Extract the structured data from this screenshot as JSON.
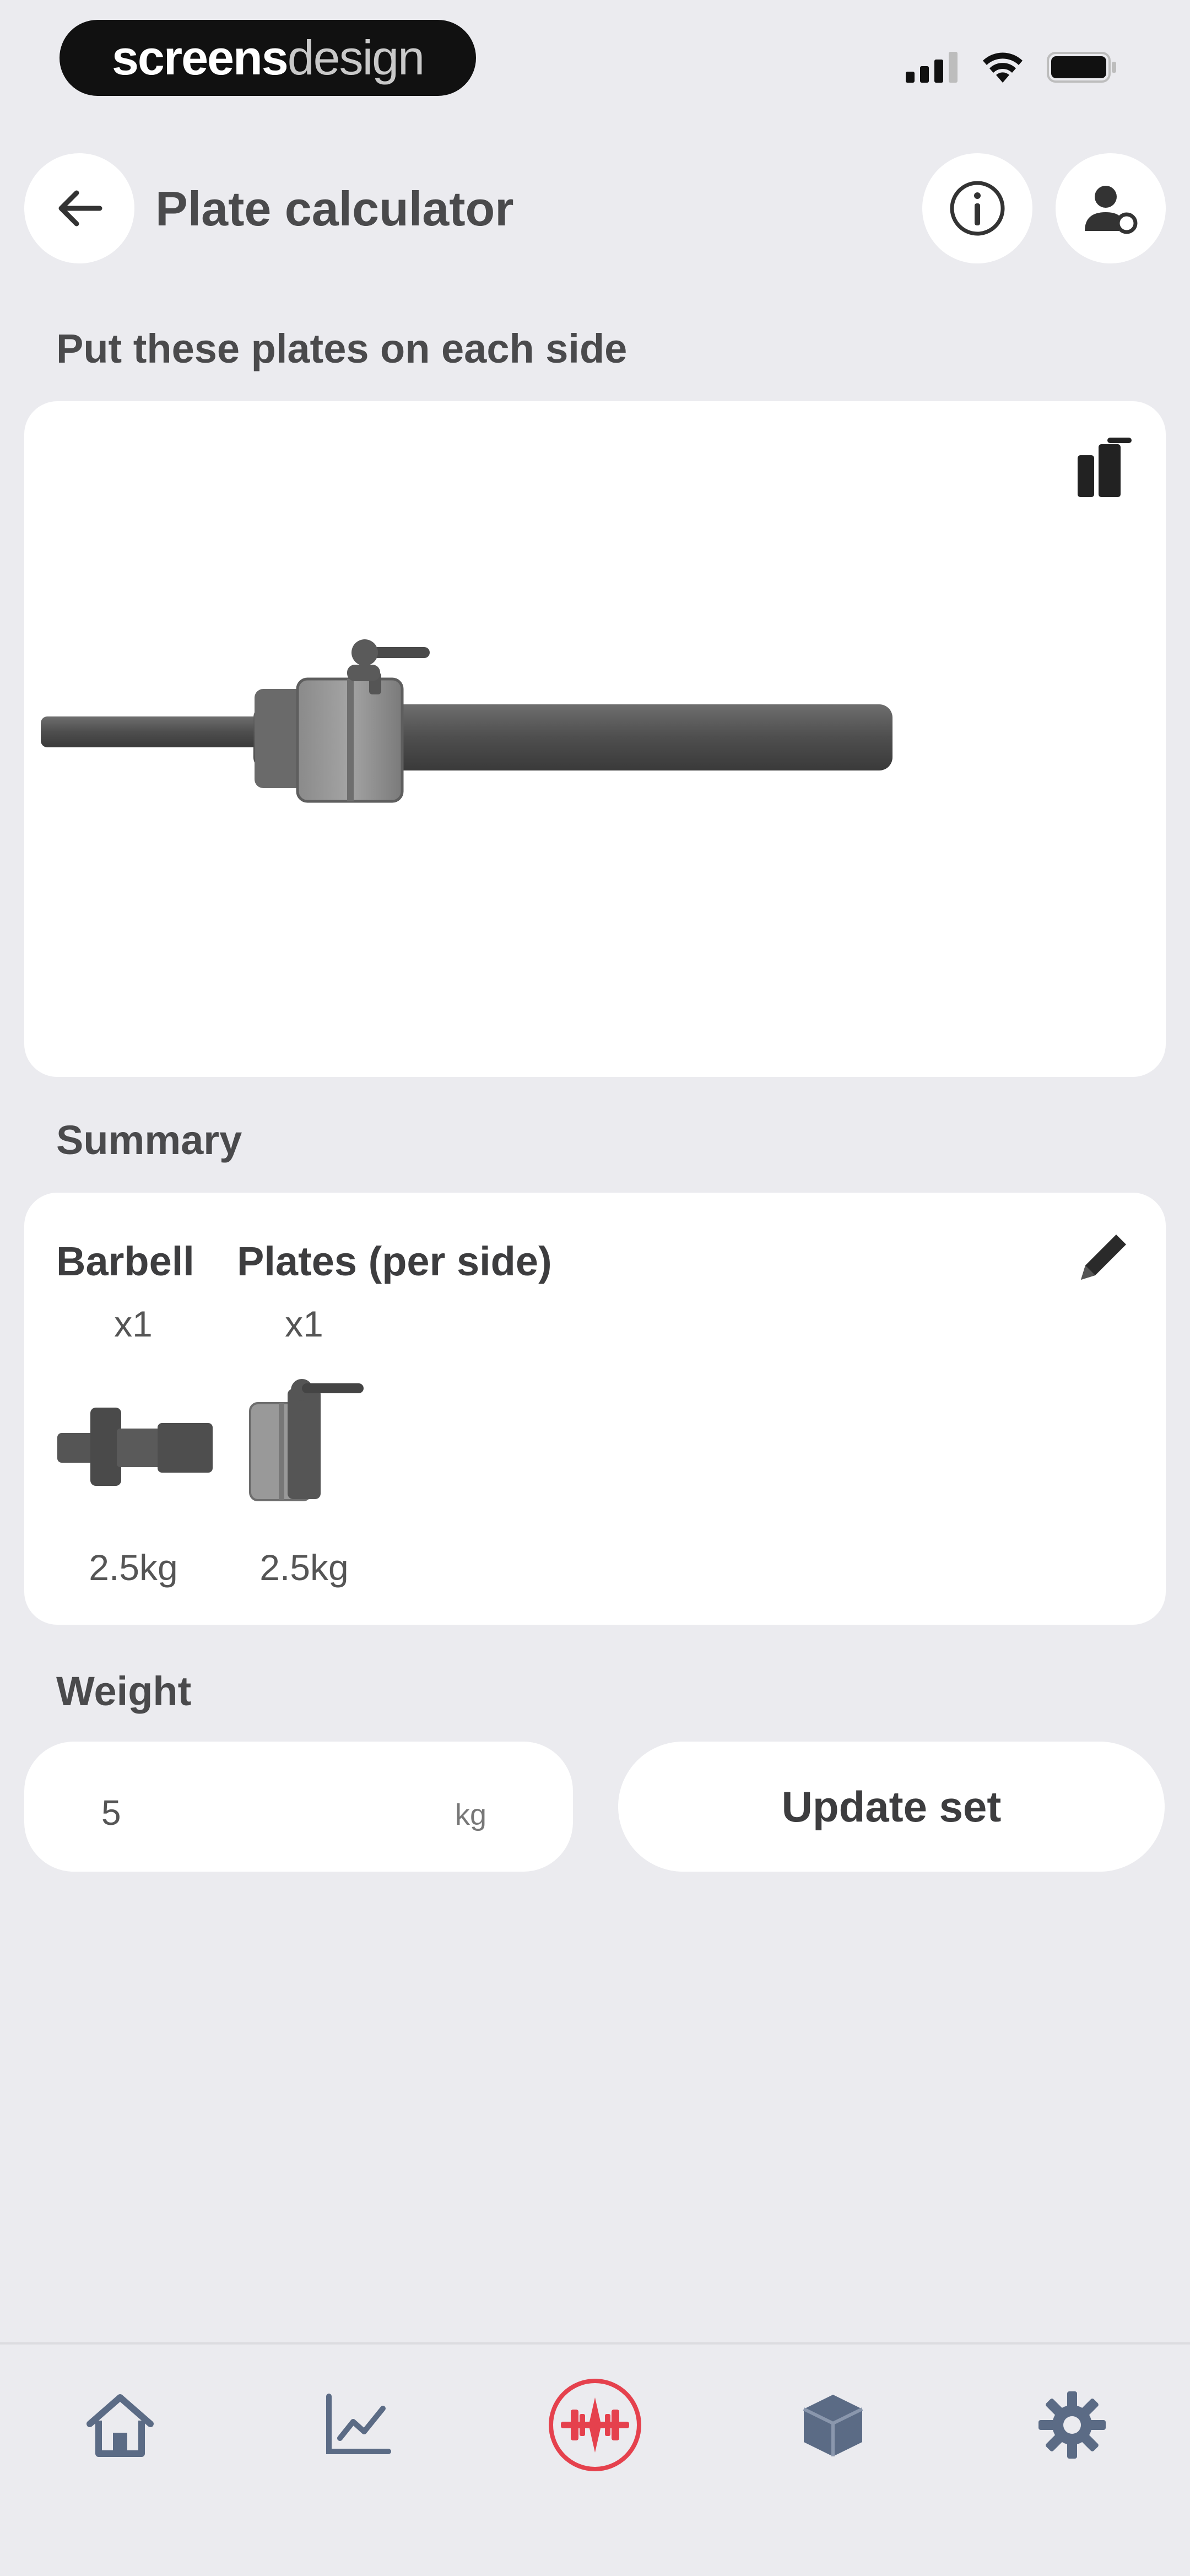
{
  "status_bar": {
    "brand_bold": "screens",
    "brand_light": "design"
  },
  "header": {
    "title": "Plate calculator",
    "back_icon": "arrow-left-icon",
    "info_icon": "info-icon",
    "profile_icon": "user-settings-icon"
  },
  "plates_section": {
    "label": "Put these plates on each side",
    "corner_icon": "plates-stack-icon"
  },
  "summary": {
    "label": "Summary",
    "edit_icon": "pencil-icon",
    "items": [
      {
        "name": "Barbell",
        "count": "x1",
        "weight": "2.5kg"
      },
      {
        "name": "Plates (per side)",
        "count": "x1",
        "weight": "2.5kg"
      }
    ]
  },
  "weight": {
    "label": "Weight",
    "value": "5",
    "unit": "kg",
    "update_label": "Update set"
  },
  "tabs": [
    {
      "id": "home",
      "icon": "home-icon"
    },
    {
      "id": "stats",
      "icon": "chart-icon"
    },
    {
      "id": "workout",
      "icon": "barbell-icon",
      "active": true
    },
    {
      "id": "inventory",
      "icon": "box-icon"
    },
    {
      "id": "settings",
      "icon": "gear-icon"
    }
  ],
  "colors": {
    "background": "#ebebef",
    "card": "#ffffff",
    "accent": "#e5414d",
    "tab_icon": "#5b6b85"
  }
}
